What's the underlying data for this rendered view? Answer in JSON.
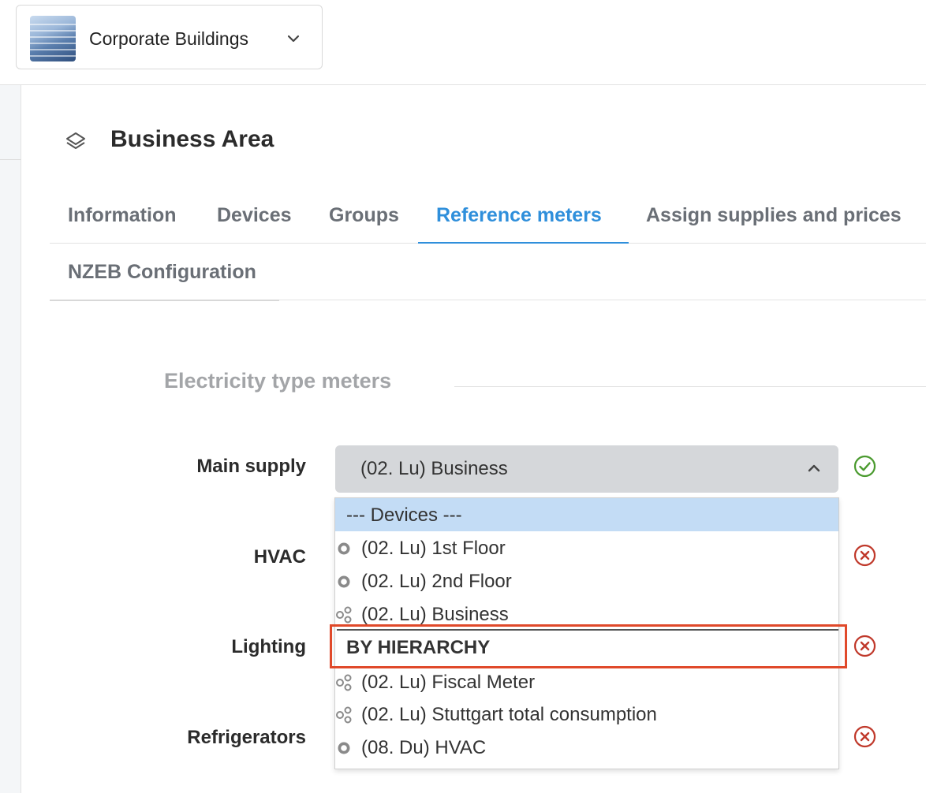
{
  "header": {
    "building_selector": {
      "title": "Corporate Buildings",
      "chevron_icon": "chevron-down-icon"
    }
  },
  "page": {
    "title": "Business Area",
    "title_icon": "layers-icon"
  },
  "tabs": [
    {
      "label": "Information",
      "active": false
    },
    {
      "label": "Devices",
      "active": false
    },
    {
      "label": "Groups",
      "active": false
    },
    {
      "label": "Reference meters",
      "active": true
    },
    {
      "label": "Assign supplies and prices",
      "active": false
    },
    {
      "label": "NZEB Configuration",
      "active": false
    }
  ],
  "section": {
    "title": "Electricity type meters"
  },
  "fields": {
    "main_supply": {
      "label": "Main supply",
      "value": "(02. Lu) Business",
      "status": "ok"
    },
    "hvac": {
      "label": "HVAC",
      "status": "error"
    },
    "lighting": {
      "label": "Lighting",
      "status": "error"
    },
    "refrigerators": {
      "label": "Refrigerators",
      "status": "error"
    }
  },
  "dropdown": {
    "options": [
      {
        "label": "--- Devices ---",
        "kind": "group-header",
        "icon": ""
      },
      {
        "label": "(02. Lu) 1st Floor",
        "kind": "device",
        "icon": "meter-icon"
      },
      {
        "label": "(02. Lu) 2nd Floor",
        "kind": "device",
        "icon": "meter-icon"
      },
      {
        "label": "(02. Lu) Business",
        "kind": "device",
        "icon": "hierarchy-icon"
      },
      {
        "label": "BY HIERARCHY",
        "kind": "group-label",
        "icon": ""
      },
      {
        "label": "(02. Lu) Fiscal Meter",
        "kind": "device",
        "icon": "hierarchy-icon"
      },
      {
        "label": "(02. Lu) Stuttgart total consumption",
        "kind": "device",
        "icon": "hierarchy-icon"
      },
      {
        "label": "(08. Du) HVAC",
        "kind": "device",
        "icon": "meter-icon"
      }
    ]
  },
  "colors": {
    "accent": "#2f8fdb",
    "ok": "#4a9a2e",
    "error": "#c0392b",
    "highlight": "#e0492a",
    "dropdown_header": "#c3dcf5"
  }
}
